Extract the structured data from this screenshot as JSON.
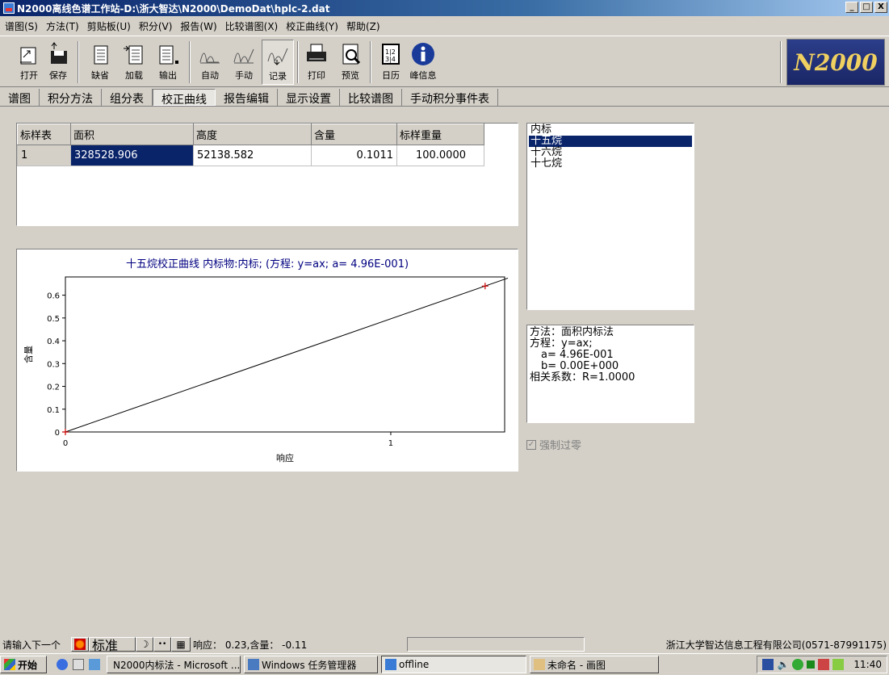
{
  "window": {
    "title": "N2000离线色谱工作站-D:\\浙大智达\\N2000\\DemoDat\\hplc-2.dat",
    "btn_min": "_",
    "btn_max": "□",
    "btn_close": "X"
  },
  "menu": [
    "谱图(S)",
    "方法(T)",
    "剪贴板(U)",
    "积分(V)",
    "报告(W)",
    "比较谱图(X)",
    "校正曲线(Y)",
    "帮助(Z)"
  ],
  "toolbar": {
    "open": "打开",
    "save": "保存",
    "default": "缺省",
    "load": "加载",
    "export": "输出",
    "auto": "自动",
    "manual": "手动",
    "record": "记录",
    "print": "打印",
    "preview": "预览",
    "calendar": "日历",
    "peakinfo": "峰信息",
    "logo": "N2000"
  },
  "tabs": [
    "谱图",
    "积分方法",
    "组分表",
    "校正曲线",
    "报告编辑",
    "显示设置",
    "比较谱图",
    "手动积分事件表"
  ],
  "table": {
    "headers": [
      "标样表",
      "面积",
      "高度",
      "含量",
      "标样重量"
    ],
    "rows": [
      [
        "1",
        "328528.906",
        "52138.582",
        "0.1011",
        "100.0000"
      ]
    ]
  },
  "list": {
    "items": [
      "内标",
      "十五烷",
      "十六烷",
      "十七烷"
    ],
    "selected": 1
  },
  "info": {
    "method": "方法：面积内标法",
    "equation": "方程：y=ax;",
    "a": "a= 4.96E-001",
    "b": "b= 0.00E+000",
    "r": "相关系数：R=1.0000"
  },
  "force_zero": "强制过零",
  "chart_data": {
    "type": "line",
    "title": "十五烷校正曲线 内标物:内标; (方程: y=ax; a= 4.96E-001)",
    "xlabel": "响应",
    "ylabel": "含量",
    "xlim": [
      0,
      1.35
    ],
    "ylim": [
      0,
      0.68
    ],
    "xticks": [
      0,
      1
    ],
    "yticks": [
      0,
      0.1,
      0.2,
      0.3,
      0.4,
      0.5,
      0.6
    ],
    "series": [
      {
        "x": [
          0,
          1.36
        ],
        "y": [
          0,
          0.675
        ]
      }
    ],
    "points": [
      {
        "x": 0,
        "y": 0
      },
      {
        "x": 1.29,
        "y": 0.64
      }
    ],
    "line_color": "#000000",
    "point_color": "#cc0000",
    "title_color": "#000080"
  },
  "status": {
    "prompt": "请输入下一个",
    "mode": "标准",
    "resp": "响应： 0.23,含量： -0.11",
    "company": "浙江大学智达信息工程有限公司(0571-87991175)"
  },
  "taskbar": {
    "start": "开始",
    "items": [
      "N2000内标法 - Microsoft ...",
      "Windows 任务管理器",
      "offline",
      "未命名 - 画图"
    ],
    "clock": "11:40"
  }
}
